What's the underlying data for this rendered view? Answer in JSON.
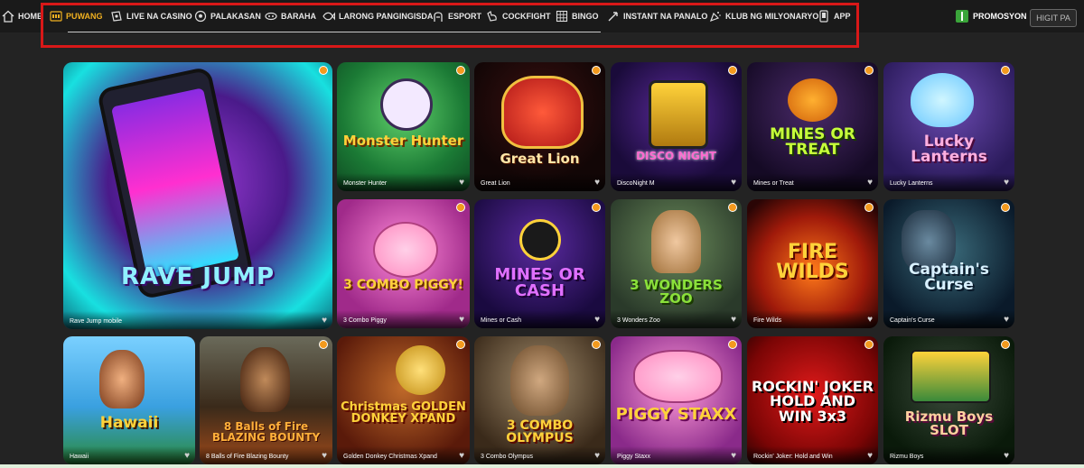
{
  "nav": {
    "items": [
      {
        "label": "HOME",
        "icon": "home-icon"
      },
      {
        "label": "PUWANG",
        "icon": "slot-machine-icon"
      },
      {
        "label": "LIVE NA CASINO",
        "icon": "live-casino-icon"
      },
      {
        "label": "PALAKASAN",
        "icon": "soccer-ball-icon"
      },
      {
        "label": "BARAHA",
        "icon": "cards-icon"
      },
      {
        "label": "LARONG PANGINGISDA",
        "icon": "fish-icon"
      },
      {
        "label": "ESPORT",
        "icon": "esport-icon"
      },
      {
        "label": "COCKFIGHT",
        "icon": "rooster-icon"
      },
      {
        "label": "BINGO",
        "icon": "bingo-icon"
      },
      {
        "label": "INSTANT NA PANALO",
        "icon": "rocket-icon"
      },
      {
        "label": "KLUB NG MILYONARYO",
        "icon": "confetti-icon"
      },
      {
        "label": "APP",
        "icon": "phone-icon"
      }
    ],
    "active": "PUWANG",
    "promo_label": "PROMOSYON",
    "more_label": "HIGIT PA",
    "accent_color": "#f0b020"
  },
  "games": [
    {
      "title": "Rave Jump mobile",
      "logo": "RAVE JUMP"
    },
    {
      "title": "Monster Hunter",
      "logo": "Monster Hunter"
    },
    {
      "title": "Great Lion",
      "logo": "Great Lion"
    },
    {
      "title": "DiscoNight M",
      "logo": "DISCO NIGHT"
    },
    {
      "title": "Mines or Treat",
      "logo": "MINES OR TREAT"
    },
    {
      "title": "Lucky Lanterns",
      "logo": "Lucky Lanterns"
    },
    {
      "title": "3 Combo Piggy",
      "logo": "3 COMBO PIGGY!"
    },
    {
      "title": "Mines or Cash",
      "logo": "MINES OR CASH"
    },
    {
      "title": "3 Wonders Zoo",
      "logo": "3 WONDERS ZOO"
    },
    {
      "title": "Fire Wilds",
      "logo": "FIRE WILDS"
    },
    {
      "title": "Captain's Curse",
      "logo": "Captain's Curse"
    },
    {
      "title": "Hawaii",
      "logo": "Hawaii"
    },
    {
      "title": "8 Balls of Fire Blazing Bounty",
      "logo": "8 Balls of Fire BLAZING BOUNTY"
    },
    {
      "title": "Golden Donkey Christmas Xpand",
      "logo": "Christmas GOLDEN DONKEY XPAND"
    },
    {
      "title": "3 Combo Olympus",
      "logo": "3 COMBO OLYMPUS"
    },
    {
      "title": "Piggy Staxx",
      "logo": "PIGGY STAXX"
    },
    {
      "title": "Rockin' Joker: Hold and Win",
      "logo": "ROCKIN' JOKER HOLD AND WIN 3x3"
    },
    {
      "title": "Rizmu Boys",
      "logo": "Rizmu Boys SLOT"
    }
  ]
}
